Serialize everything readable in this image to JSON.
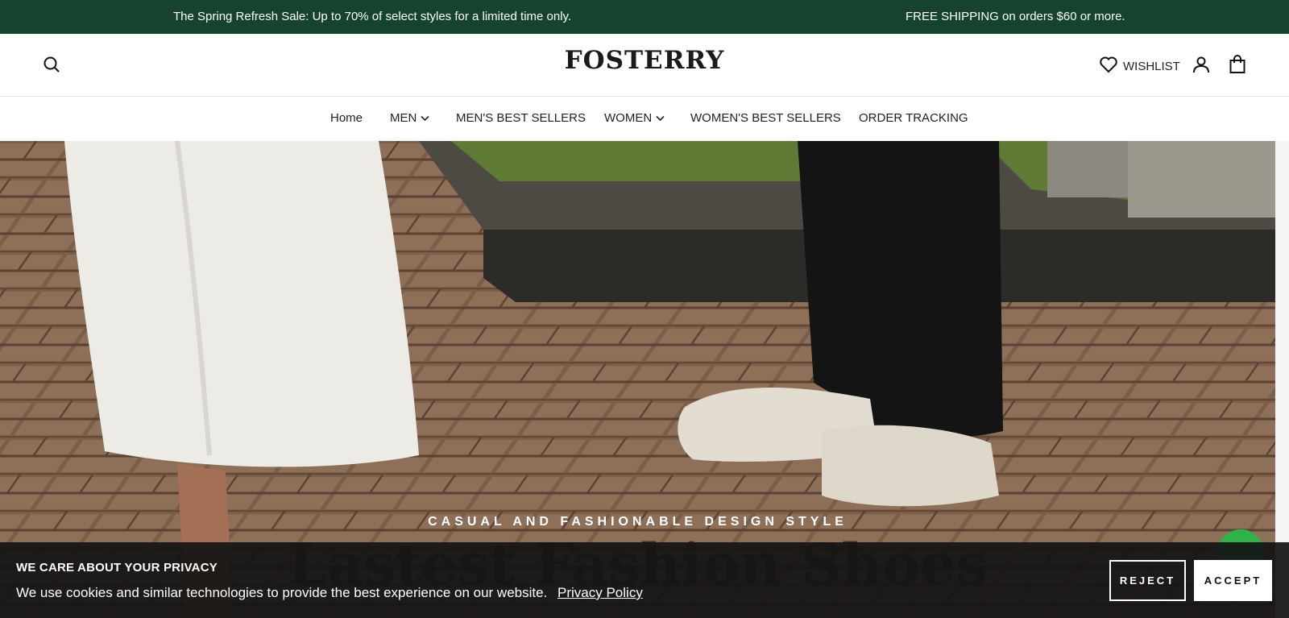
{
  "announcement": {
    "left": "The Spring Refresh Sale: Up to 70% of select styles for a limited time only.",
    "right": "FREE SHIPPING on orders $60 or more."
  },
  "header": {
    "logo": "FOSTERRY",
    "wishlist_label": "WISHLIST",
    "icons": [
      "search-icon",
      "heart-icon",
      "account-icon",
      "bag-icon"
    ]
  },
  "nav": {
    "items": [
      {
        "label": "Home",
        "dropdown": false
      },
      {
        "label": "MEN",
        "dropdown": true
      },
      {
        "label": "MEN'S BEST SELLERS",
        "dropdown": false
      },
      {
        "label": "WOMEN",
        "dropdown": true
      },
      {
        "label": "WOMEN'S BEST SELLERS",
        "dropdown": false
      },
      {
        "label": "ORDER TRACKING",
        "dropdown": false
      }
    ]
  },
  "hero": {
    "subtitle": "CASUAL AND FASHIONABLE DESIGN STYLE",
    "title": "Lastest Fashion Shoes"
  },
  "cookie": {
    "title": "WE CARE ABOUT YOUR PRIVACY",
    "body": "We use cookies and similar technologies to provide the best experience on our website.",
    "link": "Privacy Policy",
    "reject_label": "REJECT",
    "accept_label": "ACCEPT"
  },
  "colors": {
    "announcement_bg": "#16432f",
    "chat_button": "#2fb24a"
  }
}
